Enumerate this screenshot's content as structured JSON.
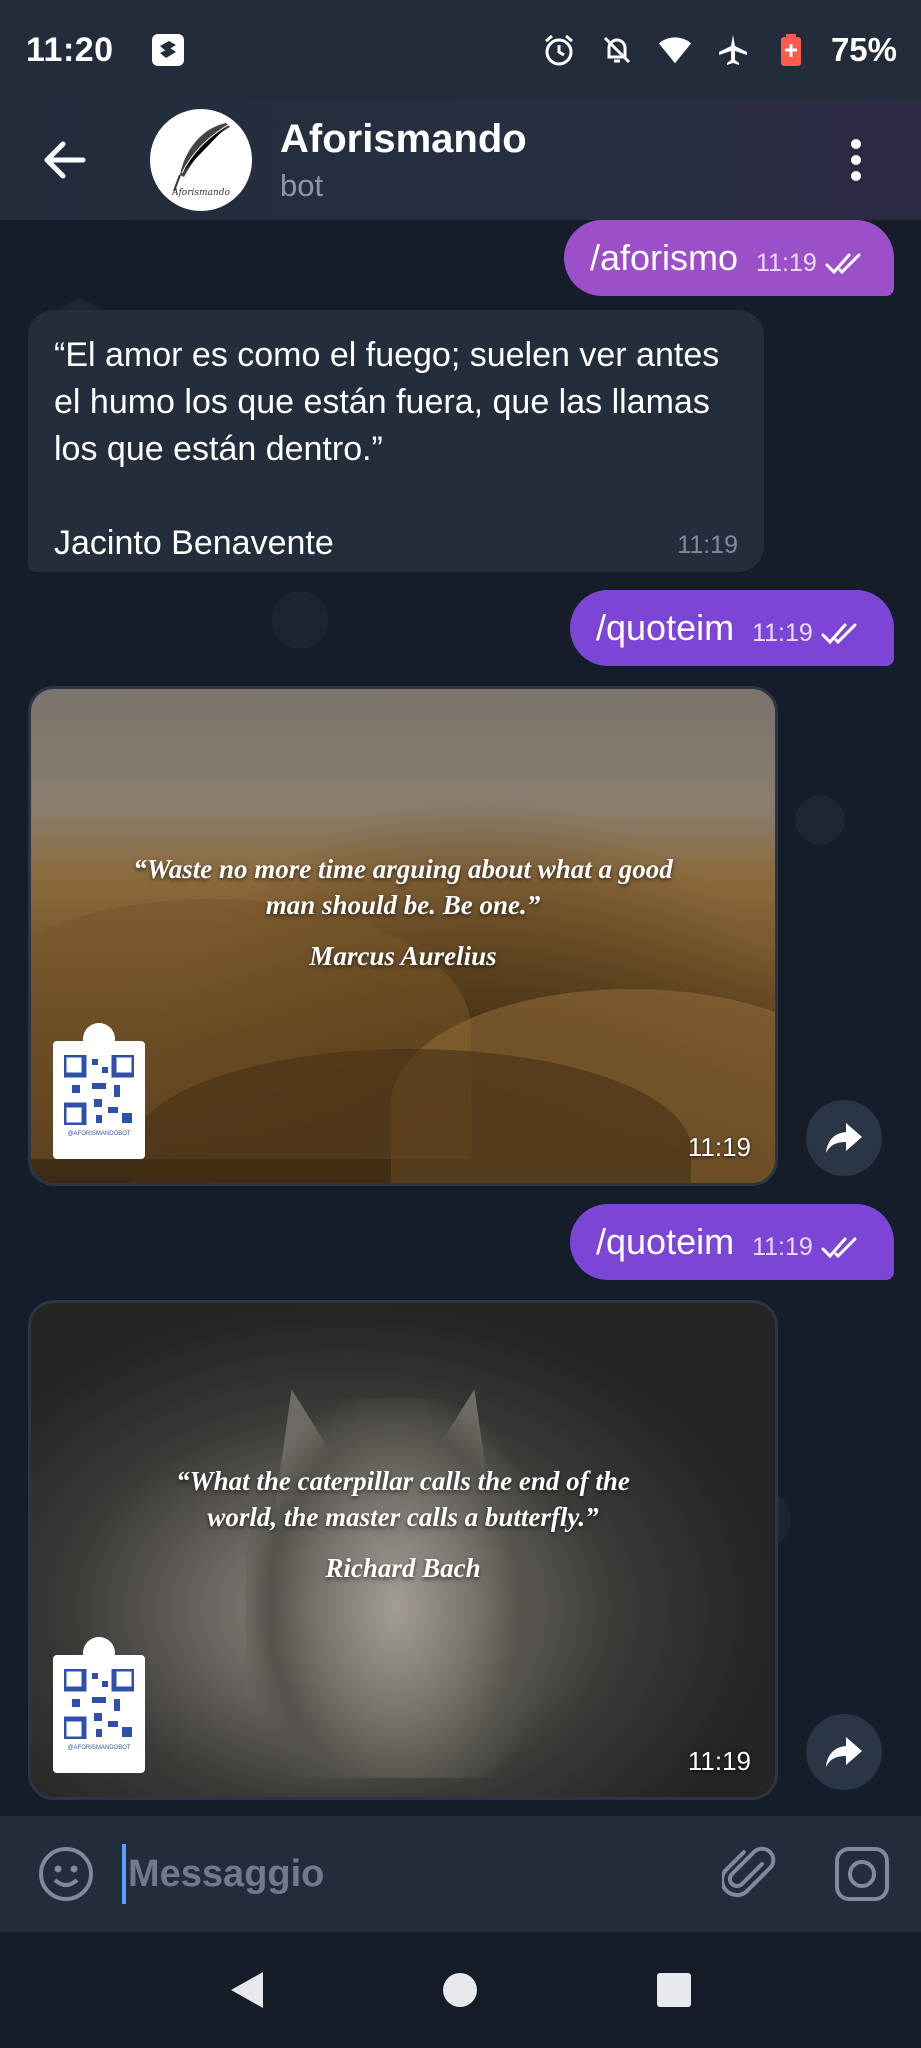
{
  "status_bar": {
    "time": "11:20",
    "battery": "75%",
    "icons": [
      "notification-icon",
      "alarm-icon",
      "mute-icon",
      "wifi-icon",
      "airplane-icon",
      "battery-icon"
    ]
  },
  "header": {
    "title": "Aforismando",
    "subtitle": "bot",
    "avatar_text": "Aforismando"
  },
  "messages": {
    "out1": {
      "text": "/aforismo",
      "time": "11:19"
    },
    "in1": {
      "text": "“El amor es como el fuego; suelen ver antes el humo los que están fuera, que las llamas los que están dentro.”",
      "author": "Jacinto Benavente",
      "time": "11:19"
    },
    "out2": {
      "text": "/quoteim",
      "time": "11:19"
    },
    "img1": {
      "quote": "“Waste no more time arguing about what a good man should be. Be one.”",
      "author": "Marcus Aurelius",
      "qr_caption": "@AFORISMANDOBOT",
      "time": "11:19"
    },
    "out3": {
      "text": "/quoteim",
      "time": "11:19"
    },
    "img2": {
      "quote": "“What the caterpillar calls the end of the world, the master calls a butterfly.”",
      "author": "Richard Bach",
      "qr_caption": "@AFORISMANDOBOT",
      "time": "11:19"
    }
  },
  "input": {
    "placeholder": "Messaggio"
  },
  "colors": {
    "out_bubble_1": "#9b4fc9",
    "out_bubble_2": "#7c45d6",
    "in_bubble": "#232d3c",
    "background": "#151d2a"
  }
}
